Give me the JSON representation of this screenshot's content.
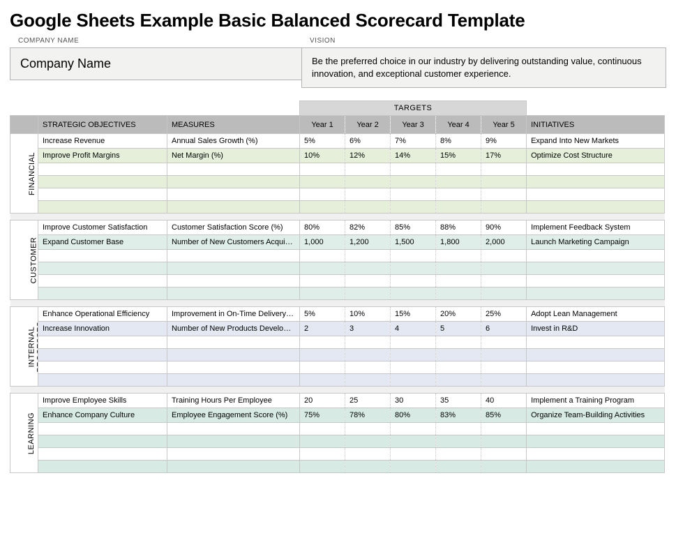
{
  "title": "Google Sheets Example Basic Balanced Scorecard Template",
  "meta": {
    "company_label": "COMPANY NAME",
    "company_value": "Company Name",
    "vision_label": "VISION",
    "vision_value": "Be the preferred choice in our industry by delivering outstanding value, continuous innovation, and exceptional customer experience."
  },
  "headers": {
    "strategic_objectives": "STRATEGIC OBJECTIVES",
    "measures": "MEASURES",
    "targets_banner": "TARGETS",
    "years": [
      "Year 1",
      "Year 2",
      "Year 3",
      "Year 4",
      "Year 5"
    ],
    "initiatives": "INITIATIVES"
  },
  "perspectives": [
    {
      "key": "financial",
      "tab": "FINANCIAL",
      "rows": [
        {
          "objective": "Increase Revenue",
          "measure": "Annual Sales Growth (%)",
          "targets": [
            "5%",
            "6%",
            "7%",
            "8%",
            "9%"
          ],
          "initiative": "Expand Into New Markets"
        },
        {
          "objective": "Improve Profit Margins",
          "measure": "Net Margin (%)",
          "targets": [
            "10%",
            "12%",
            "14%",
            "15%",
            "17%"
          ],
          "initiative": "Optimize Cost Structure"
        },
        {
          "objective": "",
          "measure": "",
          "targets": [
            "",
            "",
            "",
            "",
            ""
          ],
          "initiative": ""
        },
        {
          "objective": "",
          "measure": "",
          "targets": [
            "",
            "",
            "",
            "",
            ""
          ],
          "initiative": ""
        },
        {
          "objective": "",
          "measure": "",
          "targets": [
            "",
            "",
            "",
            "",
            ""
          ],
          "initiative": ""
        },
        {
          "objective": "",
          "measure": "",
          "targets": [
            "",
            "",
            "",
            "",
            ""
          ],
          "initiative": ""
        }
      ]
    },
    {
      "key": "customer",
      "tab": "CUSTOMER",
      "rows": [
        {
          "objective": "Improve Customer Satisfaction",
          "measure": "Customer Satisfaction Score (%)",
          "targets": [
            "80%",
            "82%",
            "85%",
            "88%",
            "90%"
          ],
          "initiative": "Implement Feedback System"
        },
        {
          "objective": "Expand Customer Base",
          "measure": "Number of New Customers Acquired",
          "targets": [
            "1,000",
            "1,200",
            "1,500",
            "1,800",
            "2,000"
          ],
          "initiative": "Launch Marketing Campaign"
        },
        {
          "objective": "",
          "measure": "",
          "targets": [
            "",
            "",
            "",
            "",
            ""
          ],
          "initiative": ""
        },
        {
          "objective": "",
          "measure": "",
          "targets": [
            "",
            "",
            "",
            "",
            ""
          ],
          "initiative": ""
        },
        {
          "objective": "",
          "measure": "",
          "targets": [
            "",
            "",
            "",
            "",
            ""
          ],
          "initiative": ""
        },
        {
          "objective": "",
          "measure": "",
          "targets": [
            "",
            "",
            "",
            "",
            ""
          ],
          "initiative": ""
        }
      ]
    },
    {
      "key": "internal",
      "tab": "INTERNAL\nPROCESSES",
      "rows": [
        {
          "objective": "Enhance Operational Efficiency",
          "measure": "Improvement in On-Time Delivery (%)",
          "targets": [
            "5%",
            "10%",
            "15%",
            "20%",
            "25%"
          ],
          "initiative": "Adopt Lean Management"
        },
        {
          "objective": "Increase Innovation",
          "measure": "Number of New Products Developed",
          "targets": [
            "2",
            "3",
            "4",
            "5",
            "6"
          ],
          "initiative": "Invest in R&D"
        },
        {
          "objective": "",
          "measure": "",
          "targets": [
            "",
            "",
            "",
            "",
            ""
          ],
          "initiative": ""
        },
        {
          "objective": "",
          "measure": "",
          "targets": [
            "",
            "",
            "",
            "",
            ""
          ],
          "initiative": ""
        },
        {
          "objective": "",
          "measure": "",
          "targets": [
            "",
            "",
            "",
            "",
            ""
          ],
          "initiative": ""
        },
        {
          "objective": "",
          "measure": "",
          "targets": [
            "",
            "",
            "",
            "",
            ""
          ],
          "initiative": ""
        }
      ]
    },
    {
      "key": "learning",
      "tab": "LEARNING",
      "rows": [
        {
          "objective": "Improve Employee Skills",
          "measure": "Training Hours Per Employee",
          "targets": [
            "20",
            "25",
            "30",
            "35",
            "40"
          ],
          "initiative": "Implement a Training Program"
        },
        {
          "objective": "Enhance Company Culture",
          "measure": "Employee Engagement Score (%)",
          "targets": [
            "75%",
            "78%",
            "80%",
            "83%",
            "85%"
          ],
          "initiative": "Organize Team-Building Activities"
        },
        {
          "objective": "",
          "measure": "",
          "targets": [
            "",
            "",
            "",
            "",
            ""
          ],
          "initiative": ""
        },
        {
          "objective": "",
          "measure": "",
          "targets": [
            "",
            "",
            "",
            "",
            ""
          ],
          "initiative": ""
        },
        {
          "objective": "",
          "measure": "",
          "targets": [
            "",
            "",
            "",
            "",
            ""
          ],
          "initiative": ""
        },
        {
          "objective": "",
          "measure": "",
          "targets": [
            "",
            "",
            "",
            "",
            ""
          ],
          "initiative": ""
        }
      ]
    }
  ]
}
